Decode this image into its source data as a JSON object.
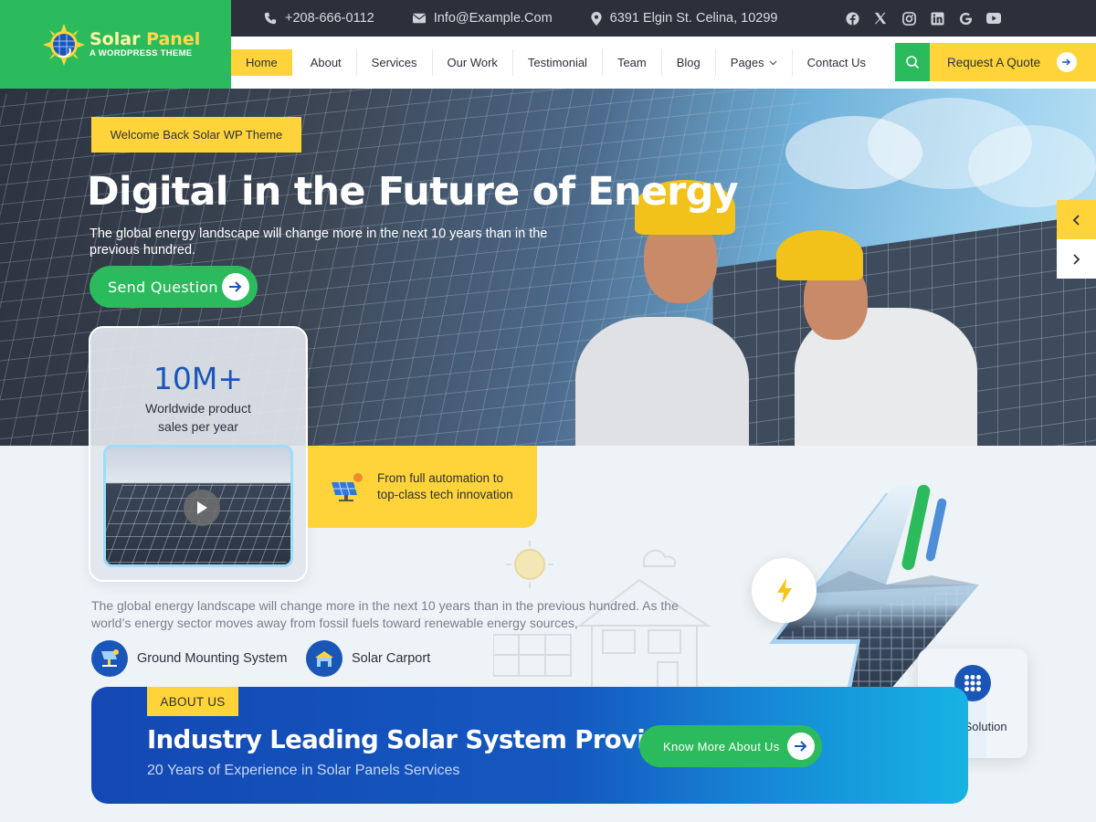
{
  "topbar": {
    "phone": "+208-666-0112",
    "email": "Info@Example.Com",
    "address": "6391 Elgin St. Celina, 10299",
    "socials": [
      "facebook-icon",
      "x-icon",
      "instagram-icon",
      "linkedin-icon",
      "google-icon",
      "youtube-icon"
    ]
  },
  "brand": {
    "name_part1": "Solar ",
    "name_part2": "Panel",
    "tagline": "A WORDPRESS THEME",
    "green": "#2cbb5c",
    "yellow": "#ffd43b",
    "blue": "#1a56b8",
    "dark": "#2d303b"
  },
  "nav": {
    "items": [
      {
        "label": "Home",
        "active": true
      },
      {
        "label": "About"
      },
      {
        "label": "Services"
      },
      {
        "label": "Our Work"
      },
      {
        "label": "Testimonial"
      },
      {
        "label": "Team"
      },
      {
        "label": "Blog"
      },
      {
        "label": "Pages"
      },
      {
        "label": "Contact Us"
      }
    ],
    "quote_label": "Request A Quote"
  },
  "hero": {
    "badge": "Welcome Back Solar WP Theme",
    "title": "Digital in the Future of Energy",
    "lead": "The global energy landscape will change more in the next 10 years than in the previous hundred.",
    "button": "Send Question"
  },
  "stats": {
    "number": "10M+",
    "desc_line1": "Worldwide product",
    "desc_line2": "sales per year"
  },
  "feature": {
    "line1": "From full automation to",
    "line2": "top-class tech innovation"
  },
  "section": {
    "description": "The global energy landscape will change more in the next 10 years than in the previous hundred. As the world’s energy sector moves away from fossil fuels toward renewable energy sources,",
    "pill1": "Ground Mounting System",
    "pill2": "Solar Carport",
    "grid_card": "Grid Solution"
  },
  "about": {
    "tag": "ABOUT US",
    "title": "Industry Leading Solar System Provider",
    "subtitle": "20 Years of Experience in Solar Panels Services",
    "button": "Know More About Us"
  }
}
